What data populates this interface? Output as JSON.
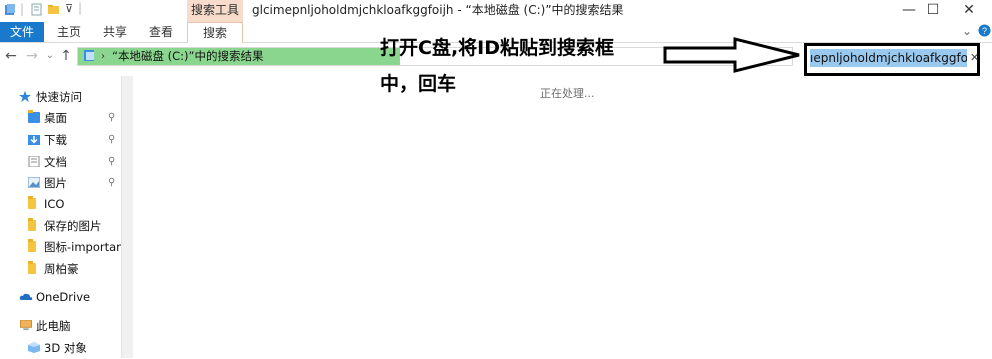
{
  "window": {
    "title": "glcimepnljoholdmjchkloafkggfoijh - “本地磁盘 (C:)”中的搜索结果",
    "context_tab_group": "搜索工具",
    "controls": {
      "minimize": "—",
      "maximize": "☐",
      "close": "✕"
    }
  },
  "ribbon": {
    "tabs": [
      "文件",
      "主页",
      "共享",
      "查看",
      "搜索"
    ],
    "collapse_glyph": "⌄",
    "help_glyph": "?"
  },
  "nav": {
    "back": "←",
    "forward": "→",
    "recent": "⌄",
    "up": "↑",
    "address": "“本地磁盘 (C:)”中的搜索结果",
    "address_dropdown": "⌄",
    "search_value": "ıepnljoholdmjchkloafkggfoijh",
    "search_clear": "✕"
  },
  "sidebar": {
    "items": [
      {
        "label": "快速访问",
        "icon": "star-icon",
        "pinned": false
      },
      {
        "label": "桌面",
        "icon": "desktop-folder-icon",
        "pinned": true
      },
      {
        "label": "下载",
        "icon": "download-folder-icon",
        "pinned": true
      },
      {
        "label": "文档",
        "icon": "documents-folder-icon",
        "pinned": true
      },
      {
        "label": "图片",
        "icon": "pictures-folder-icon",
        "pinned": true
      },
      {
        "label": "ICO",
        "icon": "folder-icon",
        "pinned": false
      },
      {
        "label": "保存的图片",
        "icon": "folder-icon",
        "pinned": false
      },
      {
        "label": "图标-important",
        "icon": "folder-icon",
        "pinned": false
      },
      {
        "label": "周柏豪",
        "icon": "folder-icon",
        "pinned": false
      },
      {
        "label": "OneDrive",
        "icon": "cloud-icon",
        "pinned": false
      },
      {
        "label": "此电脑",
        "icon": "computer-icon",
        "pinned": false
      },
      {
        "label": "3D 对象",
        "icon": "3d-objects-icon",
        "pinned": false
      }
    ],
    "pin_glyph": "📌"
  },
  "content": {
    "status": "正在处理..."
  },
  "annotation": {
    "line1": "打开C盘,将ID粘贴到搜索框",
    "line2": "中，回车"
  }
}
